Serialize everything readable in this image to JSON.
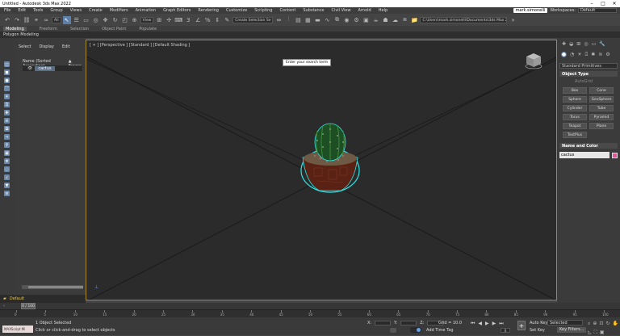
{
  "window": {
    "title": "Untitled - Autodesk 3ds Max 2022",
    "min": "–",
    "max": "□",
    "close": "✕"
  },
  "menu": {
    "items": [
      "File",
      "Edit",
      "Tools",
      "Group",
      "Views",
      "Create",
      "Modifiers",
      "Animation",
      "Graph Editors",
      "Rendering",
      "Customize",
      "Scripting",
      "Content",
      "Substance",
      "Civil View",
      "Arnold",
      "Help"
    ],
    "user": "mark.simonelli",
    "workspace_label": "Workspaces:",
    "workspace_value": "Default"
  },
  "toolbar": {
    "filter_value": "All",
    "view_value": "View",
    "selection_set_value": "Create Selection Se",
    "project_path": "C:\\Users\\mark.simonelli\\Documents\\3ds Max 2022"
  },
  "ribbon": {
    "tabs": [
      "Modeling",
      "Freeform",
      "Selection",
      "Object Paint",
      "Populate"
    ],
    "active_tab": "Modeling",
    "sub_label": "Polygon Modeling"
  },
  "scene_explorer": {
    "tabs": [
      "Select",
      "Display",
      "Edit"
    ],
    "header_name": "Name (Sorted Ascending)",
    "header_frozen": "▲ Frozen",
    "object": "cactus",
    "layer": "Default"
  },
  "viewport": {
    "label": "[ + ] [Perspective ] [Standard ] [Default Shading ]",
    "tooltip": "Enter your search term"
  },
  "command_panel": {
    "category": "Standard Primitives",
    "object_type_title": "Object Type",
    "autogrid": "AutoGrid",
    "buttons": [
      "Box",
      "Cone",
      "Sphere",
      "GeoSphere",
      "Cylinder",
      "Tube",
      "Torus",
      "Pyramid",
      "Teapot",
      "Plane",
      "TextPlus"
    ],
    "name_color_title": "Name and Color",
    "name_value": "cactus",
    "swatch_color": "#e0559a"
  },
  "timeline": {
    "slider": "0 / 100",
    "ticks": [
      "0",
      "5",
      "10",
      "15",
      "20",
      "25",
      "30",
      "35",
      "40",
      "45",
      "50",
      "55",
      "60",
      "65",
      "70",
      "75",
      "80",
      "85",
      "90",
      "95",
      "100"
    ]
  },
  "status": {
    "maxscript": "MAXScript Mi",
    "selection": "1 Object Selected",
    "prompt": "Click or click-and-drag to select objects",
    "x_label": "X:",
    "y_label": "Y:",
    "z_label": "Z:",
    "grid": "Grid = 10.0",
    "add_time_tag": "Add Time Tag",
    "auto_key": "Auto Key",
    "set_key": "Set Key",
    "selected": "Selected",
    "key_filters": "Key Filters...",
    "frame": "0"
  }
}
